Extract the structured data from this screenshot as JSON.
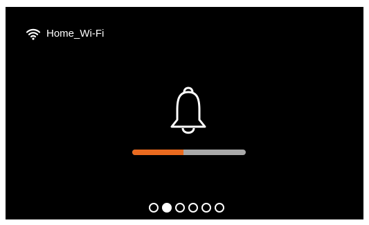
{
  "network": {
    "icon": "wifi-icon",
    "ssid": "Home_Wi-Fi"
  },
  "main": {
    "icon": "bell-icon"
  },
  "progress": {
    "fraction": 0.45,
    "fill_color": "#ea6a1f",
    "track_color": "#a9a9a9"
  },
  "pager": {
    "count": 6,
    "active_index": 1
  }
}
